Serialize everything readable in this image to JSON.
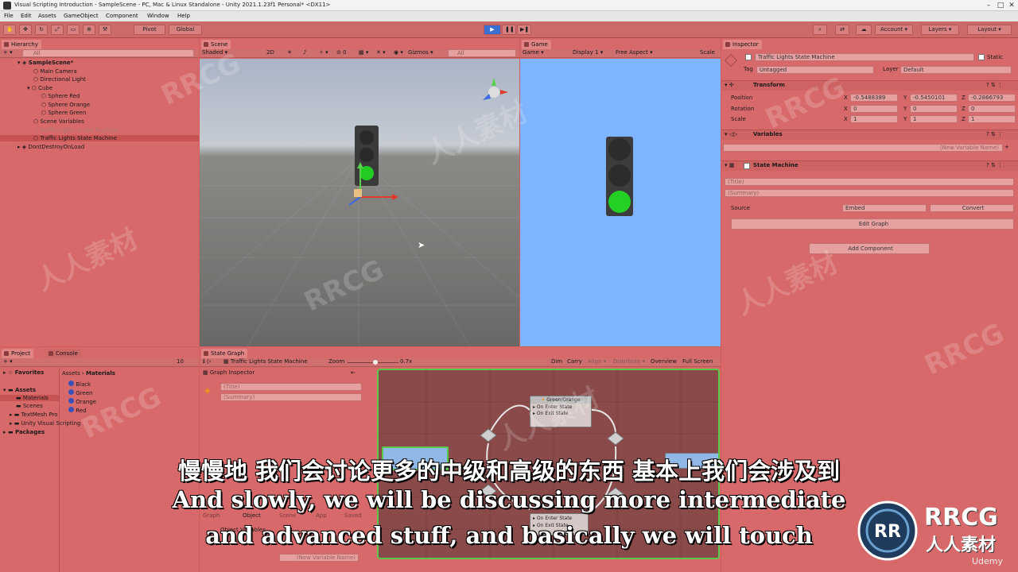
{
  "window": {
    "title": "Visual Scripting Introduction - SampleScene - PC, Mac & Linux Standalone - Unity 2021.1.23f1 Personal* <DX11>",
    "controls": [
      "–",
      "□",
      "✕"
    ]
  },
  "menu": [
    "File",
    "Edit",
    "Assets",
    "GameObject",
    "Component",
    "Window",
    "Help"
  ],
  "toolbar": {
    "pivot": "Pivot",
    "global": "Global",
    "account": "Account",
    "layers": "Layers",
    "layout": "Layout"
  },
  "hierarchy": {
    "tab": "Hierarchy",
    "search_placeholder": "All",
    "scene": "SampleScene*",
    "items": [
      {
        "label": "Main Camera",
        "indent": 1
      },
      {
        "label": "Directional Light",
        "indent": 1
      },
      {
        "label": "Cube",
        "indent": 1
      },
      {
        "label": "Sphere Red",
        "indent": 2
      },
      {
        "label": "Sphere Orange",
        "indent": 2
      },
      {
        "label": "Sphere Green",
        "indent": 2
      },
      {
        "label": "Scene Variables",
        "indent": 1
      },
      {
        "label": "Traffic Lights Script Machine",
        "indent": 1
      },
      {
        "label": "Traffic Lights State Machine",
        "indent": 1
      }
    ],
    "dont_destroy": "DontDestroyOnLoad"
  },
  "scene_view": {
    "tab": "Scene",
    "shading": "Shaded",
    "mode_2d": "2D",
    "gizmos": "Gizmos",
    "search_placeholder": "All"
  },
  "game_view": {
    "tab": "Game",
    "mode": "Game",
    "display": "Display 1",
    "aspect": "Free Aspect",
    "scale": "Scale"
  },
  "inspector": {
    "tab": "Inspector",
    "object_name": "Traffic Lights State Machine",
    "static": "Static",
    "tag_label": "Tag",
    "tag_value": "Untagged",
    "layer_label": "Layer",
    "layer_value": "Default",
    "transform": {
      "title": "Transform",
      "position_label": "Position",
      "rotation_label": "Rotation",
      "scale_label": "Scale",
      "position": [
        "-0.5488389",
        "-0.5450101",
        "-0.2866793"
      ],
      "rotation": [
        "0",
        "0",
        "0"
      ],
      "scale": [
        "1",
        "1",
        "1"
      ]
    },
    "variables": {
      "title": "Variables",
      "new_placeholder": "(New Variable Name)"
    },
    "state_machine": {
      "title": "State Machine",
      "title_placeholder": "(Title)",
      "summary_placeholder": "(Summary)",
      "source_label": "Source",
      "source_value": "Embed",
      "convert": "Convert",
      "edit_graph": "Edit Graph"
    },
    "add_component": "Add Component"
  },
  "project": {
    "tab_project": "Project",
    "tab_console": "Console",
    "favorites": "Favorites",
    "assets": "Assets",
    "tree": [
      "Materials",
      "Scenes",
      "TextMesh Pro",
      "Unity Visual Scripting"
    ],
    "packages": "Packages",
    "breadcrumb_root": "Assets",
    "breadcrumb_leaf": "Materials",
    "materials": [
      "Black",
      "Green",
      "Orange",
      "Red"
    ],
    "count": "10"
  },
  "state_graph": {
    "tab": "State Graph",
    "breadcrumb": "Traffic Lights State Machine",
    "zoom_label": "Zoom",
    "zoom_value": "0.7x",
    "dim": "Dim",
    "carry": "Carry",
    "align": "Align",
    "distribute": "Distribute",
    "overview": "Overview",
    "fullscreen": "Full Screen",
    "graph_inspector": "Graph Inspector",
    "title_placeholder": "(Title)",
    "summary_placeholder": "(Summary)",
    "node_top": "Green/Orange",
    "on_enter": "On Enter State",
    "on_exit": "On Exit State",
    "bottom_tabs": [
      "Graph",
      "Object",
      "Scene",
      "App",
      "Saved"
    ],
    "object_var": "Object Variables",
    "new_var_placeholder": "(New Variable Name)"
  },
  "subtitles": {
    "cn": "慢慢地 我们会讨论更多的中级和高级的东西 基本上我们会涉及到",
    "en1": "And slowly, we will be discussing more intermediate",
    "en2": "and advanced stuff, and basically we will touch"
  },
  "logo": {
    "brand": "RRCG",
    "brand_cn": "人人素材",
    "platform": "Udemy"
  },
  "colors": {
    "accent_green": "#5ac84a",
    "play_blue": "#3b6fd1",
    "game_sky": "#7fb5ff"
  }
}
